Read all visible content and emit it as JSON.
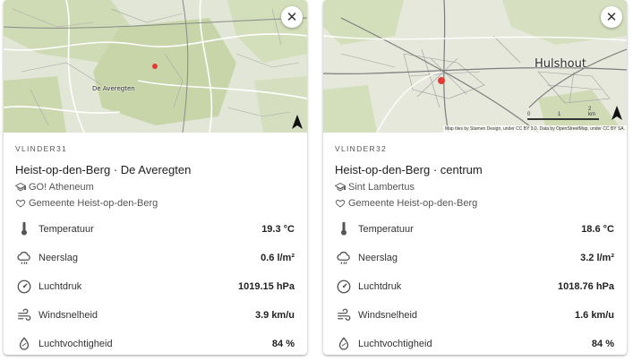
{
  "cards": [
    {
      "code": "VLINDER31",
      "title": "Heist-op-den-Berg · De Averegten",
      "school": "GO! Atheneum",
      "municipality": "Gemeente Heist-op-den-Berg",
      "map_label": "De Averegten",
      "measurements": [
        {
          "label": "Temperatuur",
          "value": "19.3 °C",
          "icon": "thermometer-icon"
        },
        {
          "label": "Neerslag",
          "value": "0.6 l/m²",
          "icon": "rain-cloud-icon"
        },
        {
          "label": "Luchtdruk",
          "value": "1019.15 hPa",
          "icon": "gauge-icon"
        },
        {
          "label": "Windsnelheid",
          "value": "3.9 km/u",
          "icon": "wind-icon"
        },
        {
          "label": "Luchtvochtigheid",
          "value": "84 %",
          "icon": "droplet-icon"
        }
      ]
    },
    {
      "code": "VLINDER32",
      "title": "Heist-op-den-Berg · centrum",
      "school": "Sint Lambertus",
      "municipality": "Gemeente Heist-op-den-Berg",
      "map_label": "Hulshout",
      "scale_ticks": [
        "0",
        "1",
        "2 km"
      ],
      "attribution": "Map tiles by Stamen Design, under CC BY 3.0. Data by OpenStreetMap, under CC BY SA.",
      "measurements": [
        {
          "label": "Temperatuur",
          "value": "18.6 °C",
          "icon": "thermometer-icon"
        },
        {
          "label": "Neerslag",
          "value": "3.2 l/m²",
          "icon": "rain-cloud-icon"
        },
        {
          "label": "Luchtdruk",
          "value": "1018.76 hPa",
          "icon": "gauge-icon"
        },
        {
          "label": "Windsnelheid",
          "value": "1.6 km/u",
          "icon": "wind-icon"
        },
        {
          "label": "Luchtvochtigheid",
          "value": "84 %",
          "icon": "droplet-icon"
        }
      ]
    }
  ],
  "close_glyph": "✕",
  "colors": {
    "marker": "#e53935",
    "map_green": "#cdd9b3",
    "map_base": "#e3e6d8",
    "road": "#ffffff",
    "label_gray": "#555555"
  }
}
